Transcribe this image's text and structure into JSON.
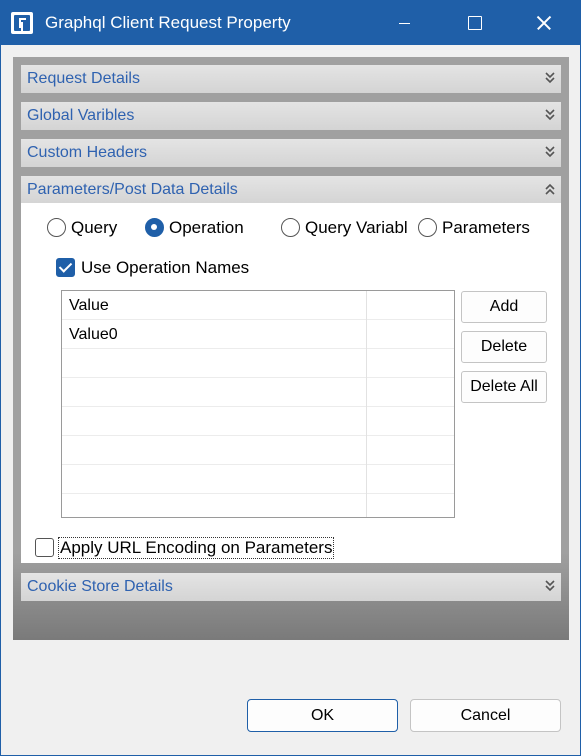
{
  "window": {
    "title": "Graphql Client Request Property"
  },
  "sections": {
    "request_details": "Request Details",
    "global_variables": "Global Varibles",
    "custom_headers": "Custom Headers",
    "parameters": "Parameters/Post Data Details",
    "cookie_store": "Cookie Store Details"
  },
  "radios": [
    {
      "label": "Query",
      "checked": false
    },
    {
      "label": "Operation",
      "checked": true
    },
    {
      "label": "Query Variabl",
      "checked": false
    },
    {
      "label": "Parameters",
      "checked": false
    }
  ],
  "use_operation_names": {
    "label": "Use Operation Names",
    "checked": true
  },
  "grid": {
    "rows": [
      "Value",
      "Value0",
      "",
      "",
      "",
      "",
      "",
      ""
    ]
  },
  "side_buttons": {
    "add": "Add",
    "delete": "Delete",
    "delete_all": "Delete All"
  },
  "apply_url_encoding": {
    "label": "Apply URL Encoding on Parameters",
    "checked": false
  },
  "footer": {
    "ok": "OK",
    "cancel": "Cancel"
  },
  "colors": {
    "titlebar": "#1f5fa8",
    "section_label": "#2f62b0",
    "panel": "#a0a0a0"
  }
}
